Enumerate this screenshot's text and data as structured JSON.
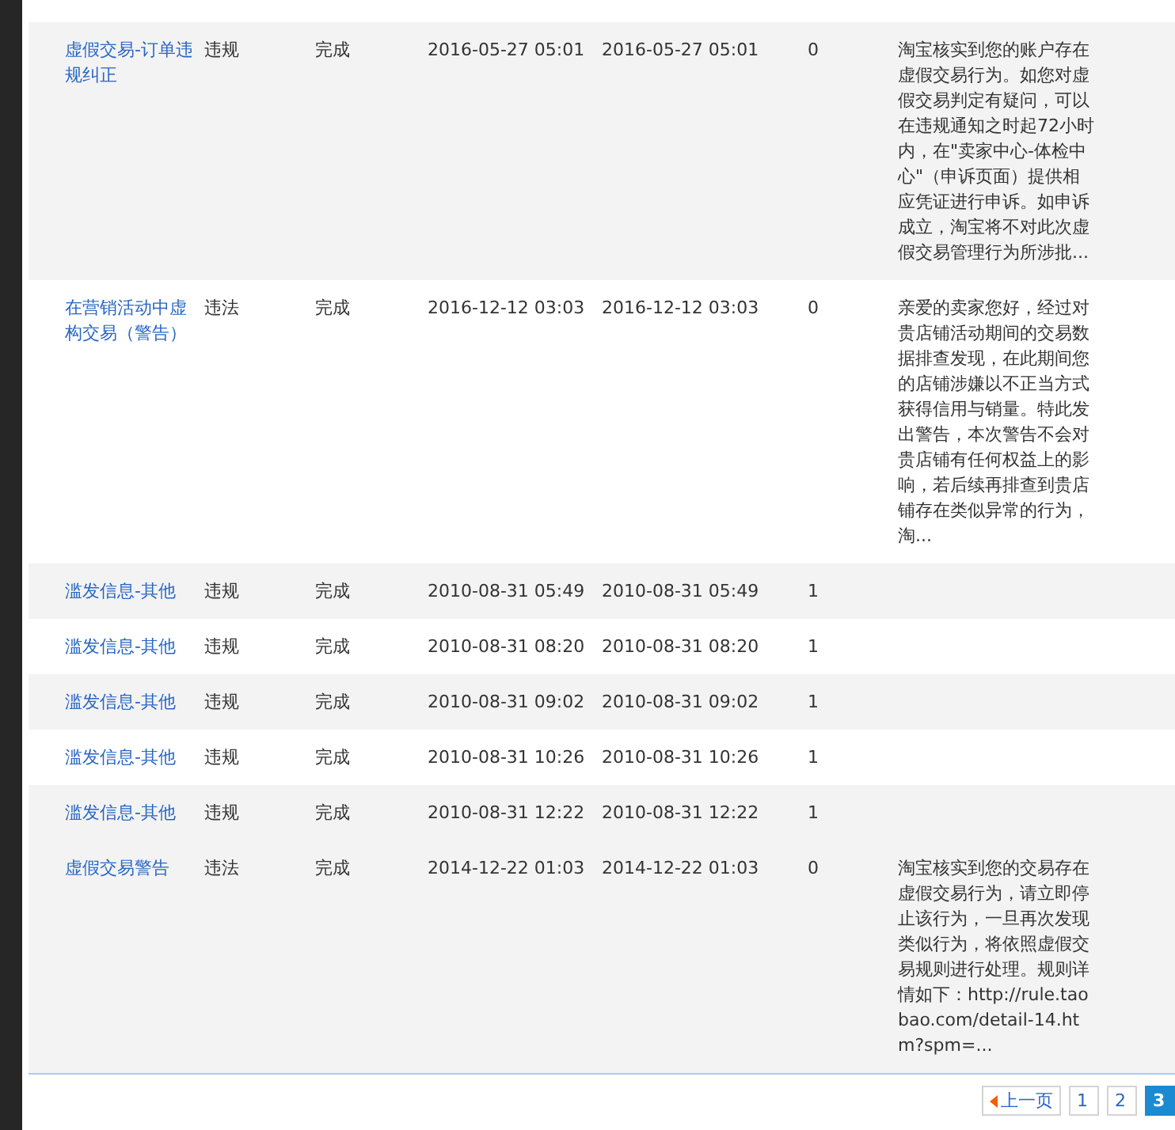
{
  "table": {
    "rows": [
      {
        "name": "虚假交易-订单违规纠正",
        "type": "违规",
        "status": "完成",
        "start_time": "2016-05-27 05:01",
        "end_time": "2016-05-27 05:01",
        "count": "0",
        "description": "淘宝核实到您的账户存在虚假交易行为。如您对虚假交易判定有疑问，可以在违规通知之时起72小时内，在\"卖家中心-体检中心\"（申诉页面）提供相应凭证进行申诉。如申诉成立，淘宝将不对此次虚假交易管理行为所涉批...",
        "shaded": true
      },
      {
        "name": "在营销活动中虚构交易（警告）",
        "type": "违法",
        "status": "完成",
        "start_time": "2016-12-12 03:03",
        "end_time": "2016-12-12 03:03",
        "count": "0",
        "description": "亲爱的卖家您好，经过对贵店铺活动期间的交易数据排查发现，在此期间您的店铺涉嫌以不正当方式获得信用与销量。特此发出警告，本次警告不会对贵店铺有任何权益上的影响，若后续再排查到贵店铺存在类似异常的行为，淘...",
        "shaded": false
      },
      {
        "name": "滥发信息-其他",
        "type": "违规",
        "status": "完成",
        "start_time": "2010-08-31 05:49",
        "end_time": "2010-08-31 05:49",
        "count": "1",
        "shaded": true
      },
      {
        "name": "滥发信息-其他",
        "type": "违规",
        "status": "完成",
        "start_time": "2010-08-31 08:20",
        "end_time": "2010-08-31 08:20",
        "count": "1",
        "shaded": false
      },
      {
        "name": "滥发信息-其他",
        "type": "违规",
        "status": "完成",
        "start_time": "2010-08-31 09:02",
        "end_time": "2010-08-31 09:02",
        "count": "1",
        "shaded": true
      },
      {
        "name": "滥发信息-其他",
        "type": "违规",
        "status": "完成",
        "start_time": "2010-08-31 10:26",
        "end_time": "2010-08-31 10:26",
        "count": "1",
        "shaded": false
      },
      {
        "name": "滥发信息-其他",
        "type": "违规",
        "status": "完成",
        "start_time": "2010-08-31 12:22",
        "end_time": "2010-08-31 12:22",
        "count": "1",
        "shaded": true
      },
      {
        "name": "虚假交易警告",
        "type": "违法",
        "status": "完成",
        "start_time": "2014-12-22 01:03",
        "end_time": "2014-12-22 01:03",
        "count": "0",
        "description": "淘宝核实到您的交易存在虚假交易行为，请立即停止该行为，一旦再次发现类似行为，将依照虚假交易规则进行处理。规则详情如下：http://rule.taobao.com/detail-14.htm?spm=...",
        "shaded": true
      }
    ]
  },
  "pagination": {
    "previous": "上一页",
    "pages": [
      {
        "label": "1",
        "selected": false
      },
      {
        "label": "2",
        "selected": false
      },
      {
        "label": "3",
        "selected": true
      }
    ]
  }
}
